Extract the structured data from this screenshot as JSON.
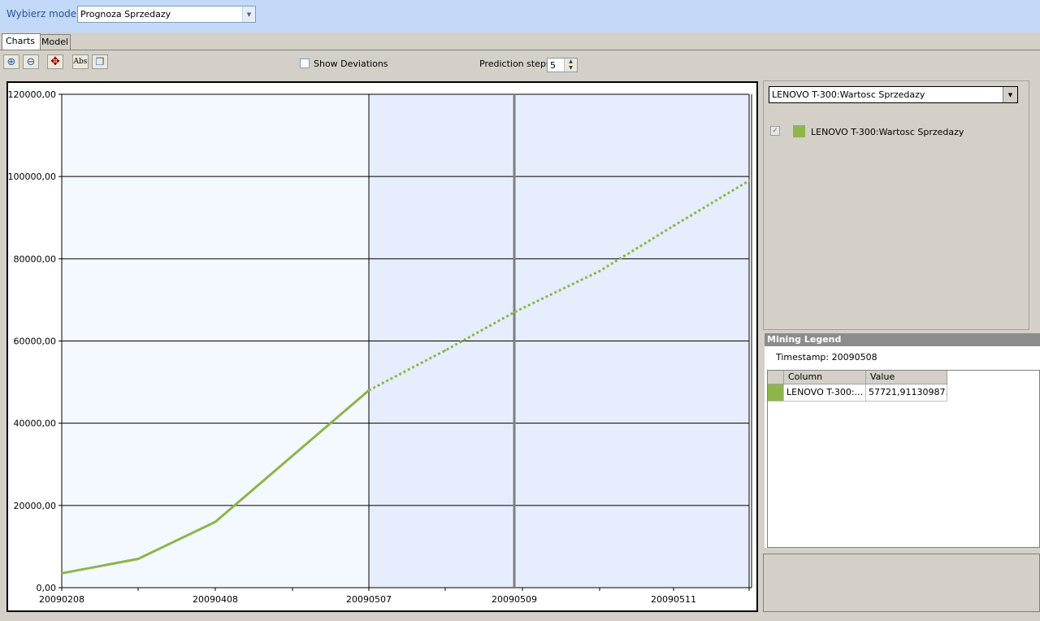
{
  "header": {
    "model_label": "Wybierz model",
    "model_value": "Prognoza Sprzedazy"
  },
  "tabs": [
    {
      "label": "Charts",
      "active": true
    },
    {
      "label": "Model",
      "active": false
    }
  ],
  "toolbar": {
    "buttons": [
      {
        "name": "zoom-in-button",
        "icon": "zoom-in-icon",
        "glyph": "⊕"
      },
      {
        "name": "zoom-out-button",
        "icon": "zoom-out-icon",
        "glyph": "⊖"
      },
      {
        "name": "reset-zoom-button",
        "icon": "expand-arrows-icon",
        "glyph": "✥"
      },
      {
        "name": "abs-button",
        "icon": "abs-icon",
        "glyph": "Abs"
      },
      {
        "name": "copy-button",
        "icon": "copy-icon",
        "glyph": "❐"
      }
    ],
    "show_deviations_label": "Show Deviations",
    "show_deviations_checked": false,
    "prediction_steps_label": "Prediction steps",
    "prediction_steps_value": "5"
  },
  "series_selector": {
    "value": "LENOVO T-300:Wartosc Sprzedazy"
  },
  "legend": {
    "items": [
      {
        "label": "LENOVO T-300:Wartosc Sprzedazy",
        "color": "#8db54c",
        "checked": true
      }
    ]
  },
  "mining_legend": {
    "title": "Mining Legend",
    "timestamp": "Timestamp: 20090508",
    "columns": [
      "Column",
      "Value"
    ],
    "rows": [
      {
        "color": "#8db54c",
        "column": "LENOVO T-300:...",
        "value": "57721,91130987..."
      }
    ]
  },
  "chart_data": {
    "type": "line",
    "ylim": [
      0,
      120000
    ],
    "yticks": [
      "0,00",
      "20000,00",
      "40000,00",
      "60000,00",
      "80000,00",
      "100000,00",
      "120000,00"
    ],
    "xticks": [
      "20090208",
      "20090408",
      "20090507",
      "20090509",
      "20090511"
    ],
    "grid": true,
    "series": [
      {
        "name": "LENOVO T-300:Wartosc Sprzedazy",
        "color": "#8db54c",
        "points": [
          {
            "x": "20090208",
            "y": 3500,
            "predicted": false
          },
          {
            "x": "20090308",
            "y": 7000,
            "predicted": false
          },
          {
            "x": "20090408",
            "y": 16000,
            "predicted": false
          },
          {
            "x": "20090507",
            "y": 48000,
            "predicted": true
          },
          {
            "x": "20090508",
            "y": 57700,
            "predicted": true
          },
          {
            "x": "20090509",
            "y": 67000,
            "predicted": true
          },
          {
            "x": "20090510",
            "y": 77000,
            "predicted": true
          },
          {
            "x": "20090511",
            "y": 88000,
            "predicted": true
          },
          {
            "x": "20090512",
            "y": 99000,
            "predicted": true
          }
        ]
      }
    ],
    "prediction_start": "20090507",
    "cursor_x": "20090509",
    "colors": {
      "history_bg": "#f4f8ff",
      "prediction_bg": "#e6edfc",
      "cursor": "#808080"
    }
  }
}
